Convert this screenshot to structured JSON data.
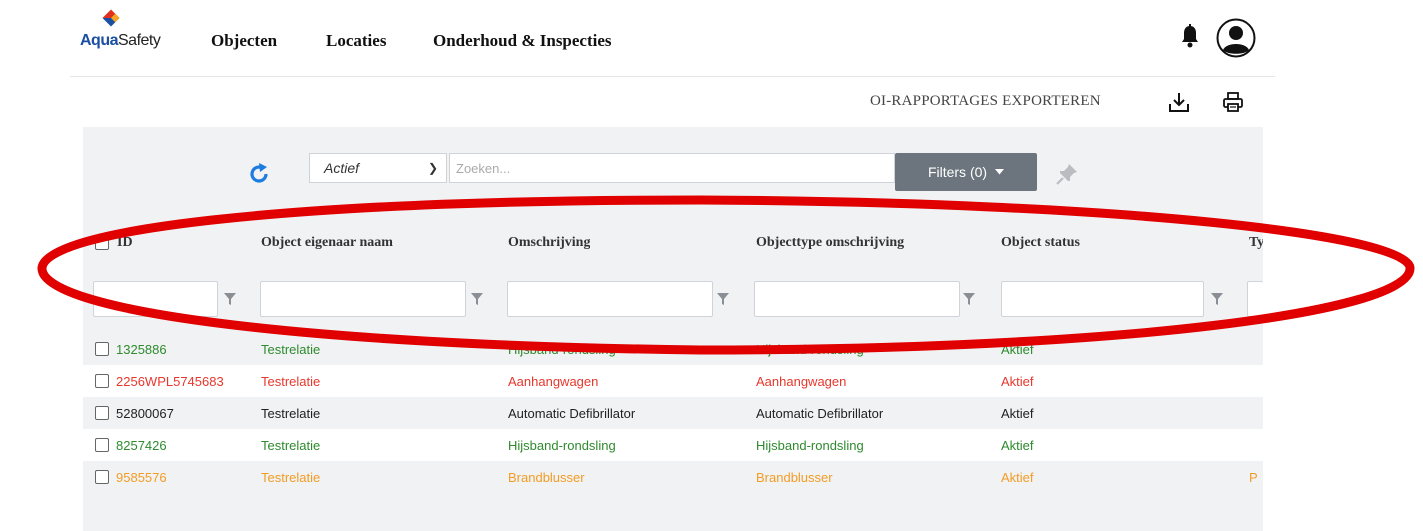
{
  "app": {
    "logo_aqua": "Aqua",
    "logo_safety": "Safety"
  },
  "nav": {
    "items": [
      {
        "label": "Objecten"
      },
      {
        "label": "Locaties"
      },
      {
        "label": "Onderhoud & Inspecties"
      }
    ]
  },
  "toolbar": {
    "export_label": "OI-RAPPORTAGES EXPORTEREN"
  },
  "filters_bar": {
    "status_value": "Actief",
    "search_placeholder": "Zoeken...",
    "filters_label": "Filters (0)"
  },
  "table": {
    "columns": [
      {
        "label": "ID"
      },
      {
        "label": "Object eigenaar naam"
      },
      {
        "label": "Omschrijving"
      },
      {
        "label": "Objecttype omschrijving"
      },
      {
        "label": "Object status"
      },
      {
        "label": "Ty"
      }
    ],
    "rows": [
      {
        "id": "1325886",
        "owner": "Testrelatie",
        "desc": "Hijsband-rondsling",
        "type": "Hijsband-rondsling",
        "status": "Aktief",
        "extra": "",
        "color": "#2e8b2e"
      },
      {
        "id": "2256WPL5745683",
        "owner": "Testrelatie",
        "desc": "Aanhangwagen",
        "type": "Aanhangwagen",
        "status": "Aktief",
        "extra": "",
        "color": "#e8372c"
      },
      {
        "id": "52800067",
        "owner": "Testrelatie",
        "desc": "Automatic Defibrillator",
        "type": "Automatic Defibrillator",
        "status": "Aktief",
        "extra": "",
        "color": "#222222"
      },
      {
        "id": "8257426",
        "owner": "Testrelatie",
        "desc": "Hijsband-rondsling",
        "type": "Hijsband-rondsling",
        "status": "Aktief",
        "extra": "",
        "color": "#2e8b2e"
      },
      {
        "id": "9585576",
        "owner": "Testrelatie",
        "desc": "Brandblusser",
        "type": "Brandblusser",
        "status": "Aktief",
        "extra": "P",
        "color": "#f39c24"
      }
    ]
  },
  "icons": {
    "refresh": "refresh-icon",
    "bell": "bell-icon",
    "avatar": "user-avatar-icon",
    "download": "download-icon",
    "print": "printer-icon",
    "pin": "pin-icon",
    "filter": "funnel-icon"
  },
  "colors": {
    "accent_blue": "#1e7be0",
    "filters_button": "#6c757d",
    "panel_bg": "#f1f2f4",
    "annotation_red": "#e00000"
  }
}
